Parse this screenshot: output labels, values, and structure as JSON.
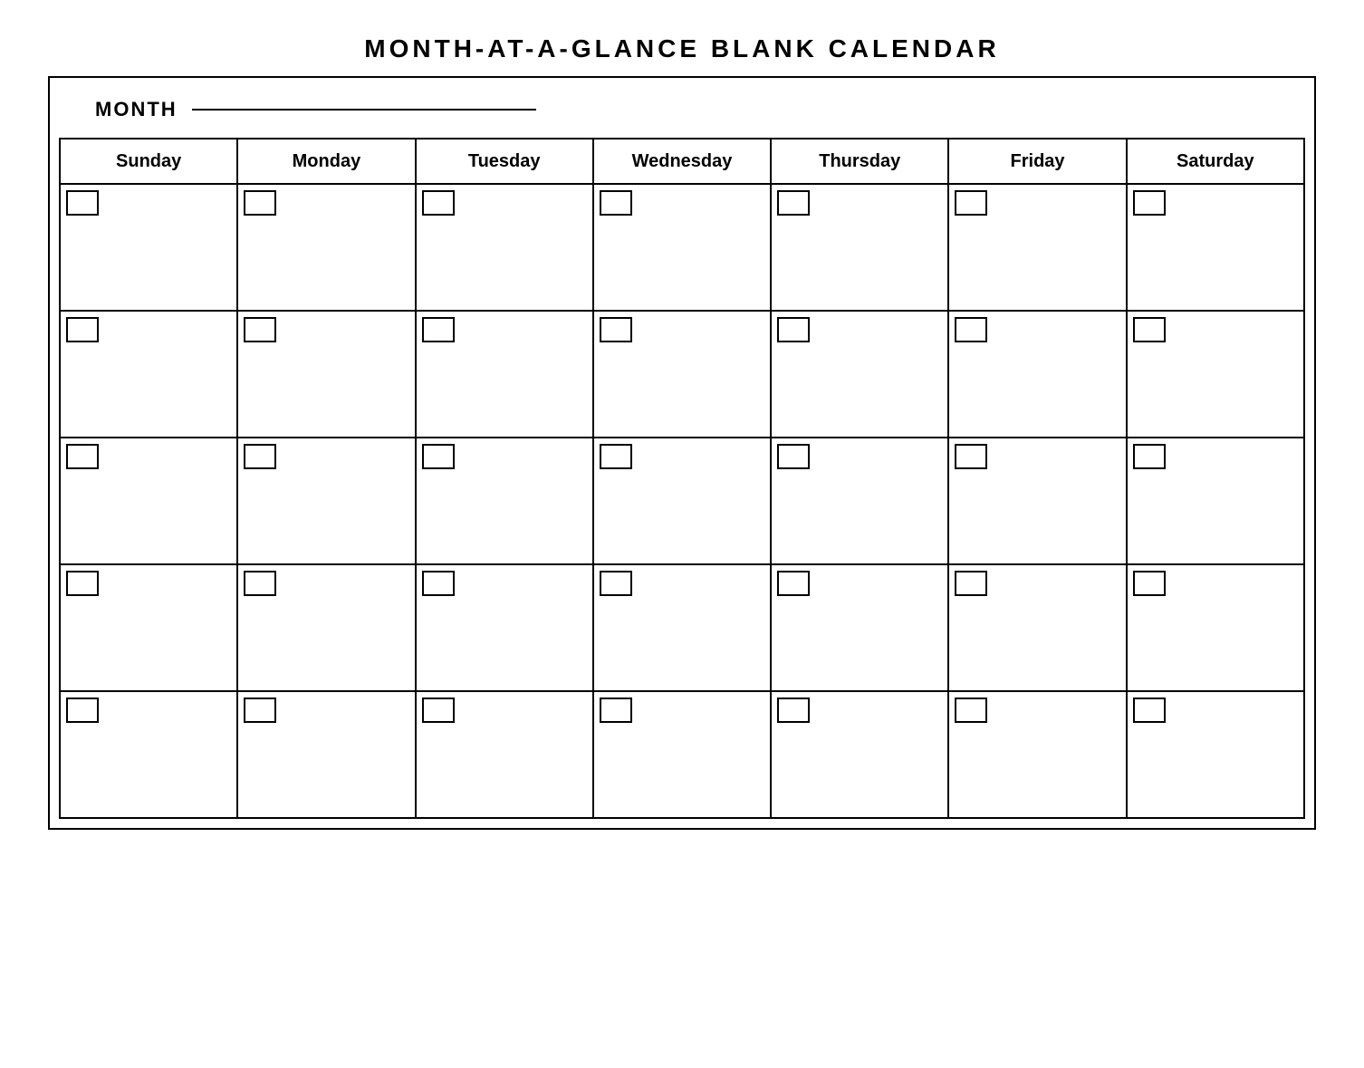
{
  "title": "MONTH-AT-A-GLANCE  BLANK  CALENDAR",
  "month_label": "MONTH",
  "days": [
    "Sunday",
    "Monday",
    "Tuesday",
    "Wednesday",
    "Thursday",
    "Friday",
    "Saturday"
  ],
  "rows": 5
}
